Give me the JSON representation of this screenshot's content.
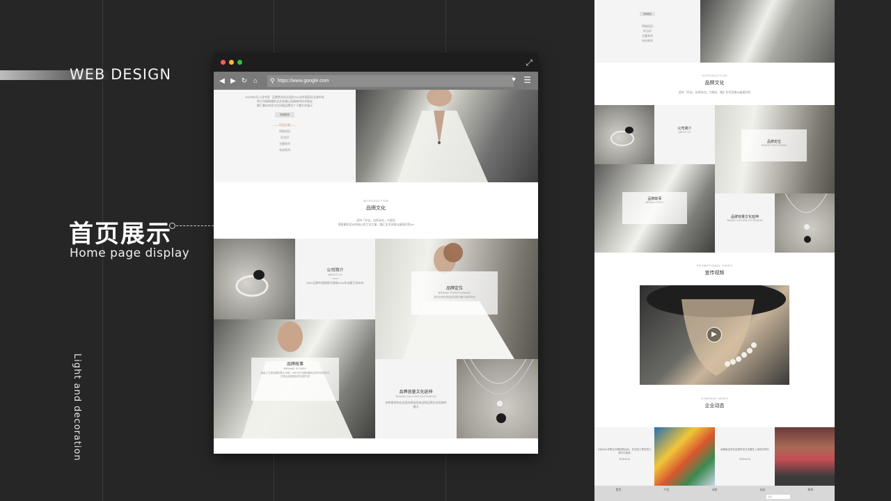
{
  "slide": {
    "web_design": "WEB DESIGN",
    "title_cn": "首页展示",
    "title_en": "Home page display",
    "vertical_text": "Light and decoration"
  },
  "browser": {
    "url": "https://www.google.com",
    "intro_lines": [
      "2009年3月入驻中国 · 品牌首次设计团队Pcb北京国际化全球市场",
      "将于风格典雅的法式浪漫以及精致的技术理念",
      "都汇集在的多方位风格品牌化个人魅力并展示"
    ],
    "more_btn": "查看更多",
    "menu_label": "—— 所品分类 ——",
    "menu_items": [
      "积极旧旧",
      "环点印",
      "主题系列",
      "年份系列"
    ],
    "brand_culture": {
      "label": "INTRODUCTION",
      "title": "品牌文化",
      "desc1": "坚持「珍宝，自然永在」为理念",
      "desc2": "探索着如设计的核心的工艺之美，融汇艺术灵感以展现时尚Art"
    },
    "about": {
      "title": "公司简介",
      "en": "ABOUT US",
      "desc": "MSG品牌中国独家代理商2019年创建于杭州市"
    },
    "positioning": {
      "title": "品牌定位",
      "en": "BRAND POSITIONING",
      "desc": "我们在崇尚质感实现的风格中追求时尚"
    },
    "story": {
      "title": "品牌故事",
      "en": "BRAND STORY",
      "desc": "高级工艺是品牌的核心中枢，MSG在与国际最前沿的时尚同步中打造出品牌独特的优雅气质"
    },
    "extension": {
      "title": "品牌容量文化延伸",
      "en": "BRAND CULTURE EXTENSION",
      "desc": "你所看到的在这里的表现用来诠释品牌文化的独特魅力"
    }
  },
  "right": {
    "more_btn": "查看更多",
    "menu_items": [
      "积极旧旧",
      "环点印",
      "主题系列",
      "年份系列"
    ],
    "brand_culture": {
      "label": "INTRODUCTION",
      "title": "品牌文化",
      "desc": "坚持「珍宝，自然永在」为理念 · 融汇艺术灵感以展现时尚"
    },
    "about": {
      "title": "公司简介",
      "en": "ABOUT US"
    },
    "positioning": {
      "title": "品牌定位",
      "en": "BRAND POSITIONING"
    },
    "story": {
      "title": "品牌故事",
      "en": "BRAND STORY"
    },
    "extension": {
      "title": "品牌容量文化延伸",
      "en": "BRAND CULTURE EXTENSION"
    },
    "promo": {
      "label": "PROMOTIONAL VIDEO",
      "title": "宣传视频"
    },
    "news": {
      "label": "COMPANY NEWS",
      "title": "企业动态",
      "item1": "与杭州大学联合开展校园活动，并在前三季的热门排行中居首",
      "date1": "2019.8.15",
      "item2": "品牌新品发布会暨时尚艺术展在上海成功举办",
      "date2": "2019.8.15"
    },
    "footer": [
      "首页",
      "产品",
      "动态",
      "社区",
      "联系"
    ],
    "search_placeholder": "搜索"
  },
  "colors": {
    "background": "#262626",
    "accent": "#c58b6d"
  }
}
